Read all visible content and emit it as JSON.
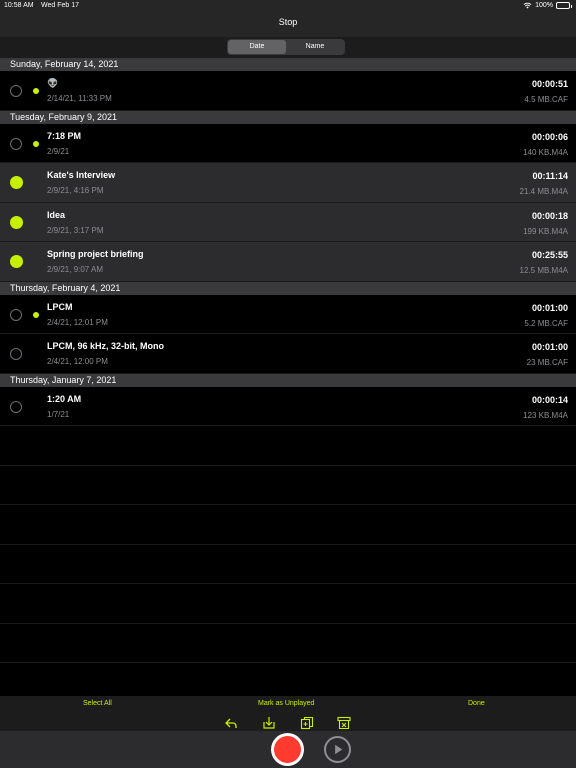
{
  "status": {
    "time": "10:58 AM",
    "date": "Wed Feb 17",
    "battery": "100%"
  },
  "nav": {
    "title": "Stop"
  },
  "sort": {
    "options": [
      "Date",
      "Name"
    ],
    "selected": "Date"
  },
  "sections": [
    {
      "header": "Sunday, February 14, 2021",
      "rows": [
        {
          "name": "👽",
          "sub": "2/14/21, 11:33 PM",
          "duration": "00:00:51",
          "size": "4.5 MB.CAF",
          "unplayed": true,
          "selected": false
        }
      ]
    },
    {
      "header": "Tuesday, February 9, 2021",
      "rows": [
        {
          "name": "7:18 PM",
          "sub": "2/9/21",
          "duration": "00:00:06",
          "size": "140 KB.M4A",
          "unplayed": true,
          "selected": false
        },
        {
          "name": "Kate's Interview",
          "sub": "2/9/21, 4:16 PM",
          "duration": "00:11:14",
          "size": "21.4 MB.M4A",
          "unplayed": false,
          "selected": true
        },
        {
          "name": "Idea",
          "sub": "2/9/21, 3:17 PM",
          "duration": "00:00:18",
          "size": "199 KB.M4A",
          "unplayed": false,
          "selected": true
        },
        {
          "name": "Spring project briefing",
          "sub": "2/9/21, 9:07 AM",
          "duration": "00:25:55",
          "size": "12.5 MB.M4A",
          "unplayed": false,
          "selected": true
        }
      ]
    },
    {
      "header": "Thursday, February 4, 2021",
      "rows": [
        {
          "name": "LPCM",
          "sub": "2/4/21, 12:01 PM",
          "duration": "00:01:00",
          "size": "5.2 MB.CAF",
          "unplayed": true,
          "selected": false
        },
        {
          "name": "LPCM, 96 kHz, 32-bit, Mono",
          "sub": "2/4/21, 12:00 PM",
          "duration": "00:01:00",
          "size": "23 MB.CAF",
          "unplayed": false,
          "selected": false
        }
      ]
    },
    {
      "header": "Thursday, January 7, 2021",
      "rows": [
        {
          "name": "1:20 AM",
          "sub": "1/7/21",
          "duration": "00:00:14",
          "size": "123 KB.M4A",
          "unplayed": false,
          "selected": false
        }
      ]
    }
  ],
  "actions": {
    "select_all": "Select All",
    "mark_unplayed": "Mark as Unplayed",
    "done": "Done"
  },
  "toolbar_icons": [
    "reply-icon",
    "download-icon",
    "duplicate-icon",
    "trash-icon"
  ],
  "colors": {
    "accent": "#c7f000",
    "record": "#ff3b30"
  }
}
